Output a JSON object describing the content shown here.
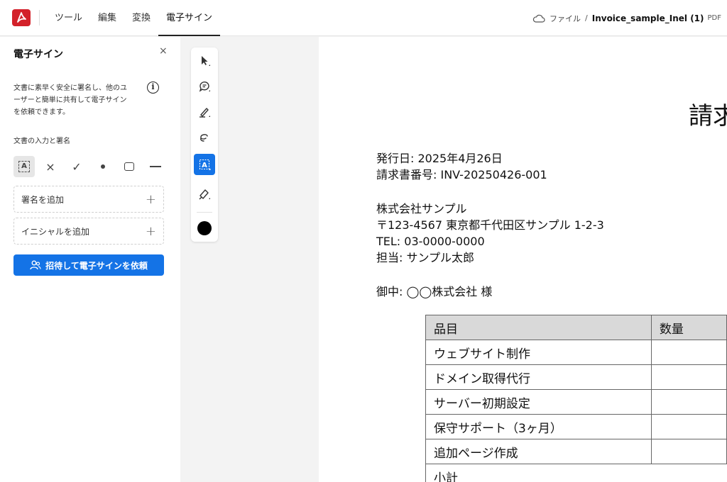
{
  "app": {
    "nav": [
      "ツール",
      "編集",
      "変換",
      "電子サイン"
    ],
    "active_nav": "電子サイン",
    "breadcrumb": {
      "location": "ファイル",
      "separator": "/",
      "filename": "Invoice_sample_Inel (1)",
      "filetype": "PDF"
    },
    "accent_color": "#1473e6",
    "brand_color": "#d3212a"
  },
  "panel": {
    "title": "電子サイン",
    "close": "×",
    "description_lines": [
      "文書に素早く安全に署名し、他のユ",
      "ーザーと簡単に共有して電子サイン",
      "を依頼できます。"
    ],
    "info": "i",
    "section_label": "文書の入力と署名",
    "tools": [
      {
        "icon": "text-field-icon",
        "glyph": "A"
      },
      {
        "icon": "cross-mark-icon",
        "glyph": "×"
      },
      {
        "icon": "checkmark-icon",
        "glyph": "✓"
      },
      {
        "icon": "dot-icon",
        "glyph": ""
      },
      {
        "icon": "rectangle-icon",
        "glyph": ""
      },
      {
        "icon": "line-icon",
        "glyph": ""
      }
    ],
    "add_signature": "署名を追加",
    "add_initials": "イニシャルを追加",
    "plus": "+",
    "cta": "招待して電子サインを依頼"
  },
  "toolbar": {
    "tools": [
      "select-cursor-icon",
      "comment-icon",
      "highlight-pen-icon",
      "lasso-icon",
      "text-field-icon",
      "signature-pen-icon"
    ],
    "active_tool": "text-field-icon",
    "text_field_glyph": "A",
    "current_color": "#000000"
  },
  "document": {
    "title": "請求",
    "issue_date": "発行日: 2025年4月26日",
    "invoice_number": "請求書番号: INV-20250426-001",
    "company": "株式会社サンプル",
    "address": "〒123-4567 東京都千代田区サンプル 1-2-3",
    "tel": "TEL: 03-0000-0000",
    "contact": "担当: サンプル太郎",
    "recipient": "御中: ◯◯株式会社 様",
    "table": {
      "headers": [
        "品目",
        "数量"
      ],
      "rows": [
        [
          "ウェブサイト制作",
          ""
        ],
        [
          "ドメイン取得代行",
          ""
        ],
        [
          "サーバー初期設定",
          ""
        ],
        [
          "保守サポート（3ヶ月）",
          ""
        ],
        [
          "追加ページ作成",
          ""
        ],
        [
          "小計",
          ""
        ]
      ]
    }
  }
}
